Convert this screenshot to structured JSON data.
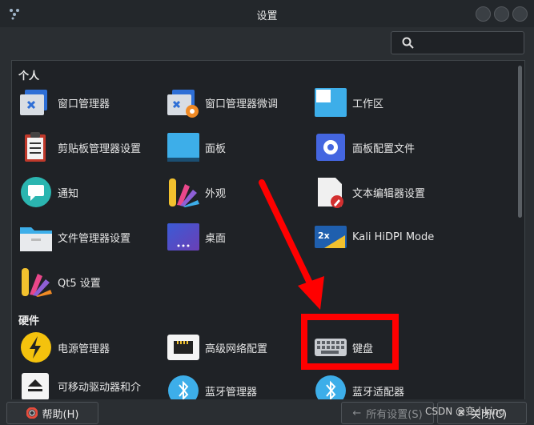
{
  "window": {
    "title": "设置"
  },
  "search": {
    "placeholder": ""
  },
  "sections": {
    "personal": "个人",
    "hardware": "硬件"
  },
  "items": [
    {
      "label": "窗口管理器",
      "icon": "window-manager-icon"
    },
    {
      "label": "窗口管理器微调",
      "icon": "window-manager-tweaks-icon"
    },
    {
      "label": "工作区",
      "icon": "workspaces-icon"
    },
    {
      "label": "剪贴板管理器设置",
      "icon": "clipboard-icon"
    },
    {
      "label": "面板",
      "icon": "panel-icon"
    },
    {
      "label": "面板配置文件",
      "icon": "panel-profiles-icon"
    },
    {
      "label": "通知",
      "icon": "notifications-icon"
    },
    {
      "label": "外观",
      "icon": "appearance-icon"
    },
    {
      "label": "文本编辑器设置",
      "icon": "text-editor-icon"
    },
    {
      "label": "文件管理器设置",
      "icon": "file-manager-icon"
    },
    {
      "label": "桌面",
      "icon": "desktop-icon"
    },
    {
      "label": "Kali HiDPI Mode",
      "icon": "hidpi-icon"
    },
    {
      "label": "Qt5 设置",
      "icon": "qt5-settings-icon"
    },
    {
      "label": "电源管理器",
      "icon": "power-manager-icon"
    },
    {
      "label": "高级网络配置",
      "icon": "network-icon"
    },
    {
      "label": "键盘",
      "icon": "keyboard-icon"
    },
    {
      "label": "可移动驱动器和介",
      "icon": "removable-drives-icon"
    },
    {
      "label": "蓝牙管理器",
      "icon": "bluetooth-icon"
    },
    {
      "label": "蓝牙适配器",
      "icon": "bluetooth-icon"
    }
  ],
  "buttons": {
    "help": "帮助(H)",
    "all_settings": "所有设置(S)",
    "close": "关闭(C)"
  },
  "watermark": "CSDN @变小king",
  "colors": {
    "highlight": "#ff0000",
    "accent_blue": "#3daee9"
  }
}
